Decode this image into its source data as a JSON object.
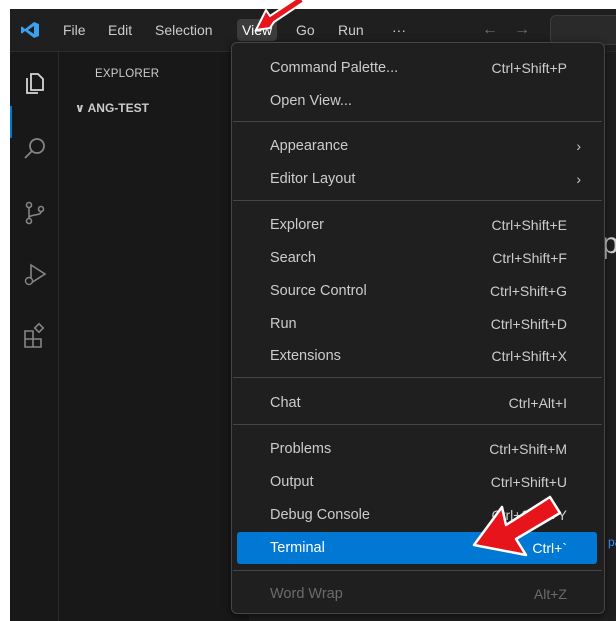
{
  "titlebar": {
    "menus": [
      "File",
      "Edit",
      "Selection",
      "View",
      "Go",
      "Run",
      "···"
    ],
    "active_menu": "View",
    "back_arrow": "←",
    "forward_arrow": "→"
  },
  "activity_bar": {
    "icons": [
      "explorer-icon",
      "search-icon",
      "source-control-icon",
      "run-debug-icon",
      "extensions-icon"
    ]
  },
  "sidebar": {
    "title": "EXPLORER",
    "folder": "ANG-TEST",
    "folder_chevron": "∨"
  },
  "editor": {
    "partial_glyph": "p",
    "partial_link": "pa"
  },
  "view_menu": {
    "items": [
      {
        "label": "Command Palette...",
        "shortcut": "Ctrl+Shift+P"
      },
      {
        "label": "Open View...",
        "shortcut": ""
      },
      {
        "label": "Appearance",
        "submenu": "›"
      },
      {
        "label": "Editor Layout",
        "submenu": "›"
      },
      {
        "label": "Explorer",
        "shortcut": "Ctrl+Shift+E"
      },
      {
        "label": "Search",
        "shortcut": "Ctrl+Shift+F"
      },
      {
        "label": "Source Control",
        "shortcut": "Ctrl+Shift+G"
      },
      {
        "label": "Run",
        "shortcut": "Ctrl+Shift+D"
      },
      {
        "label": "Extensions",
        "shortcut": "Ctrl+Shift+X"
      },
      {
        "label": "Chat",
        "shortcut": "Ctrl+Alt+I"
      },
      {
        "label": "Problems",
        "shortcut": "Ctrl+Shift+M"
      },
      {
        "label": "Output",
        "shortcut": "Ctrl+Shift+U"
      },
      {
        "label": "Debug Console",
        "shortcut": "Ctrl+Shift+Y"
      },
      {
        "label": "Terminal",
        "shortcut": "Ctrl+`",
        "highlighted": true
      },
      {
        "label": "Word Wrap",
        "shortcut": "Alt+Z",
        "disabled": true
      }
    ]
  },
  "colors": {
    "accent": "#0078d4",
    "annotation_arrow": "#e8141c"
  }
}
